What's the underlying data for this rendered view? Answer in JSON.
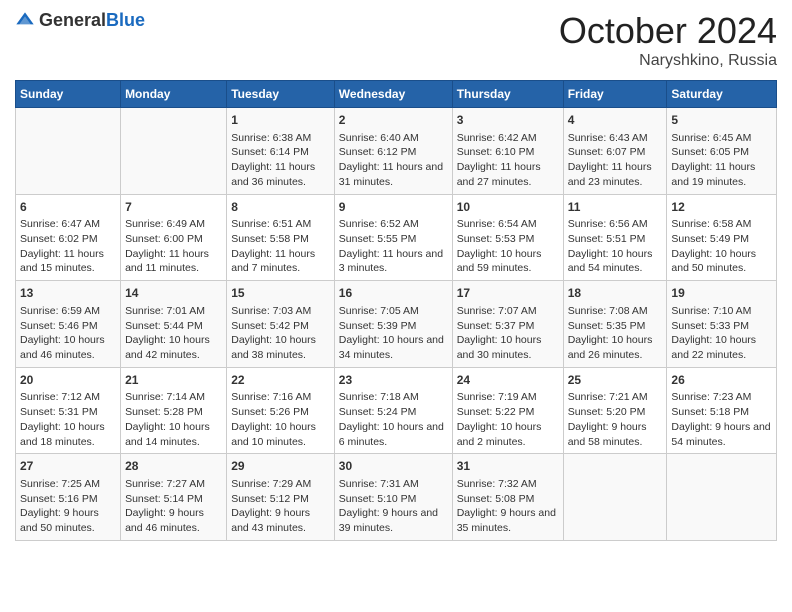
{
  "header": {
    "logo_general": "General",
    "logo_blue": "Blue",
    "month": "October 2024",
    "location": "Naryshkino, Russia"
  },
  "days_of_week": [
    "Sunday",
    "Monday",
    "Tuesday",
    "Wednesday",
    "Thursday",
    "Friday",
    "Saturday"
  ],
  "weeks": [
    [
      {
        "day": "",
        "info": ""
      },
      {
        "day": "",
        "info": ""
      },
      {
        "day": "1",
        "info": "Sunrise: 6:38 AM\nSunset: 6:14 PM\nDaylight: 11 hours and 36 minutes."
      },
      {
        "day": "2",
        "info": "Sunrise: 6:40 AM\nSunset: 6:12 PM\nDaylight: 11 hours and 31 minutes."
      },
      {
        "day": "3",
        "info": "Sunrise: 6:42 AM\nSunset: 6:10 PM\nDaylight: 11 hours and 27 minutes."
      },
      {
        "day": "4",
        "info": "Sunrise: 6:43 AM\nSunset: 6:07 PM\nDaylight: 11 hours and 23 minutes."
      },
      {
        "day": "5",
        "info": "Sunrise: 6:45 AM\nSunset: 6:05 PM\nDaylight: 11 hours and 19 minutes."
      }
    ],
    [
      {
        "day": "6",
        "info": "Sunrise: 6:47 AM\nSunset: 6:02 PM\nDaylight: 11 hours and 15 minutes."
      },
      {
        "day": "7",
        "info": "Sunrise: 6:49 AM\nSunset: 6:00 PM\nDaylight: 11 hours and 11 minutes."
      },
      {
        "day": "8",
        "info": "Sunrise: 6:51 AM\nSunset: 5:58 PM\nDaylight: 11 hours and 7 minutes."
      },
      {
        "day": "9",
        "info": "Sunrise: 6:52 AM\nSunset: 5:55 PM\nDaylight: 11 hours and 3 minutes."
      },
      {
        "day": "10",
        "info": "Sunrise: 6:54 AM\nSunset: 5:53 PM\nDaylight: 10 hours and 59 minutes."
      },
      {
        "day": "11",
        "info": "Sunrise: 6:56 AM\nSunset: 5:51 PM\nDaylight: 10 hours and 54 minutes."
      },
      {
        "day": "12",
        "info": "Sunrise: 6:58 AM\nSunset: 5:49 PM\nDaylight: 10 hours and 50 minutes."
      }
    ],
    [
      {
        "day": "13",
        "info": "Sunrise: 6:59 AM\nSunset: 5:46 PM\nDaylight: 10 hours and 46 minutes."
      },
      {
        "day": "14",
        "info": "Sunrise: 7:01 AM\nSunset: 5:44 PM\nDaylight: 10 hours and 42 minutes."
      },
      {
        "day": "15",
        "info": "Sunrise: 7:03 AM\nSunset: 5:42 PM\nDaylight: 10 hours and 38 minutes."
      },
      {
        "day": "16",
        "info": "Sunrise: 7:05 AM\nSunset: 5:39 PM\nDaylight: 10 hours and 34 minutes."
      },
      {
        "day": "17",
        "info": "Sunrise: 7:07 AM\nSunset: 5:37 PM\nDaylight: 10 hours and 30 minutes."
      },
      {
        "day": "18",
        "info": "Sunrise: 7:08 AM\nSunset: 5:35 PM\nDaylight: 10 hours and 26 minutes."
      },
      {
        "day": "19",
        "info": "Sunrise: 7:10 AM\nSunset: 5:33 PM\nDaylight: 10 hours and 22 minutes."
      }
    ],
    [
      {
        "day": "20",
        "info": "Sunrise: 7:12 AM\nSunset: 5:31 PM\nDaylight: 10 hours and 18 minutes."
      },
      {
        "day": "21",
        "info": "Sunrise: 7:14 AM\nSunset: 5:28 PM\nDaylight: 10 hours and 14 minutes."
      },
      {
        "day": "22",
        "info": "Sunrise: 7:16 AM\nSunset: 5:26 PM\nDaylight: 10 hours and 10 minutes."
      },
      {
        "day": "23",
        "info": "Sunrise: 7:18 AM\nSunset: 5:24 PM\nDaylight: 10 hours and 6 minutes."
      },
      {
        "day": "24",
        "info": "Sunrise: 7:19 AM\nSunset: 5:22 PM\nDaylight: 10 hours and 2 minutes."
      },
      {
        "day": "25",
        "info": "Sunrise: 7:21 AM\nSunset: 5:20 PM\nDaylight: 9 hours and 58 minutes."
      },
      {
        "day": "26",
        "info": "Sunrise: 7:23 AM\nSunset: 5:18 PM\nDaylight: 9 hours and 54 minutes."
      }
    ],
    [
      {
        "day": "27",
        "info": "Sunrise: 7:25 AM\nSunset: 5:16 PM\nDaylight: 9 hours and 50 minutes."
      },
      {
        "day": "28",
        "info": "Sunrise: 7:27 AM\nSunset: 5:14 PM\nDaylight: 9 hours and 46 minutes."
      },
      {
        "day": "29",
        "info": "Sunrise: 7:29 AM\nSunset: 5:12 PM\nDaylight: 9 hours and 43 minutes."
      },
      {
        "day": "30",
        "info": "Sunrise: 7:31 AM\nSunset: 5:10 PM\nDaylight: 9 hours and 39 minutes."
      },
      {
        "day": "31",
        "info": "Sunrise: 7:32 AM\nSunset: 5:08 PM\nDaylight: 9 hours and 35 minutes."
      },
      {
        "day": "",
        "info": ""
      },
      {
        "day": "",
        "info": ""
      }
    ]
  ]
}
